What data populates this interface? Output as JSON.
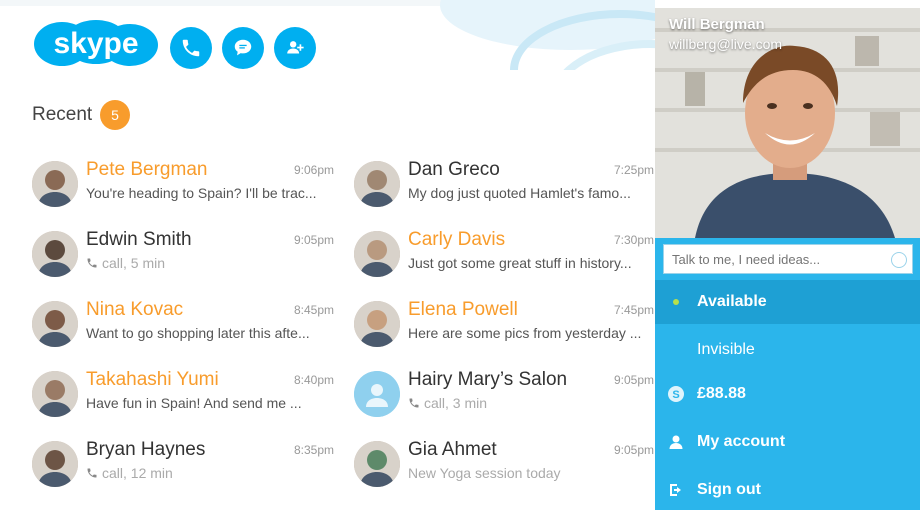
{
  "app": {
    "logo_text": "skype"
  },
  "header": {
    "call_icon": "phone-icon",
    "chat_icon": "chat-icon",
    "add_contact_icon": "add-contact-icon"
  },
  "recent": {
    "title": "Recent",
    "badge": "5"
  },
  "contacts": [
    {
      "name": "Pete Bergman",
      "time": "9:06pm",
      "message": "You're heading to Spain? I'll be trac...",
      "highlight": true,
      "call": false
    },
    {
      "name": "Dan Greco",
      "time": "7:25pm",
      "message": "My dog just quoted Hamlet's famo...",
      "highlight": false,
      "call": false
    },
    {
      "name": "Edwin Smith",
      "time": "9:05pm",
      "message": "call, 5 min",
      "highlight": false,
      "call": true
    },
    {
      "name": "Carly Davis",
      "time": "7:30pm",
      "message": "Just got some great stuff in history...",
      "highlight": true,
      "call": false
    },
    {
      "name": "Nina Kovac",
      "time": "8:45pm",
      "message": "Want to go shopping later this afte...",
      "highlight": true,
      "call": false
    },
    {
      "name": "Elena Powell",
      "time": "7:45pm",
      "message": "Here are some pics from yesterday ...",
      "highlight": true,
      "call": false
    },
    {
      "name": "Takahashi Yumi",
      "time": "8:40pm",
      "message": "Have fun in Spain! And send me ...",
      "highlight": true,
      "call": false
    },
    {
      "name": "Hairy Mary’s Salon",
      "time": "9:05pm",
      "message": "call, 3 min",
      "highlight": false,
      "call": true
    },
    {
      "name": "Bryan Haynes",
      "time": "8:35pm",
      "message": "call, 12 min",
      "highlight": false,
      "call": true
    },
    {
      "name": "Gia Ahmet",
      "time": "9:05pm",
      "message": "New Yoga session today",
      "highlight": false,
      "call": false
    }
  ],
  "profile": {
    "name": "Will Bergman",
    "email": "willberg@live.com",
    "mood_placeholder": "Talk to me, I need ideas..."
  },
  "menu": {
    "available": "Available",
    "invisible": "Invisible",
    "credit": "£88.88",
    "my_account": "My account",
    "sign_out": "Sign out"
  },
  "colors": {
    "accent": "#00aff0",
    "orange": "#f89c2c",
    "panel": "#2bb5eb"
  }
}
